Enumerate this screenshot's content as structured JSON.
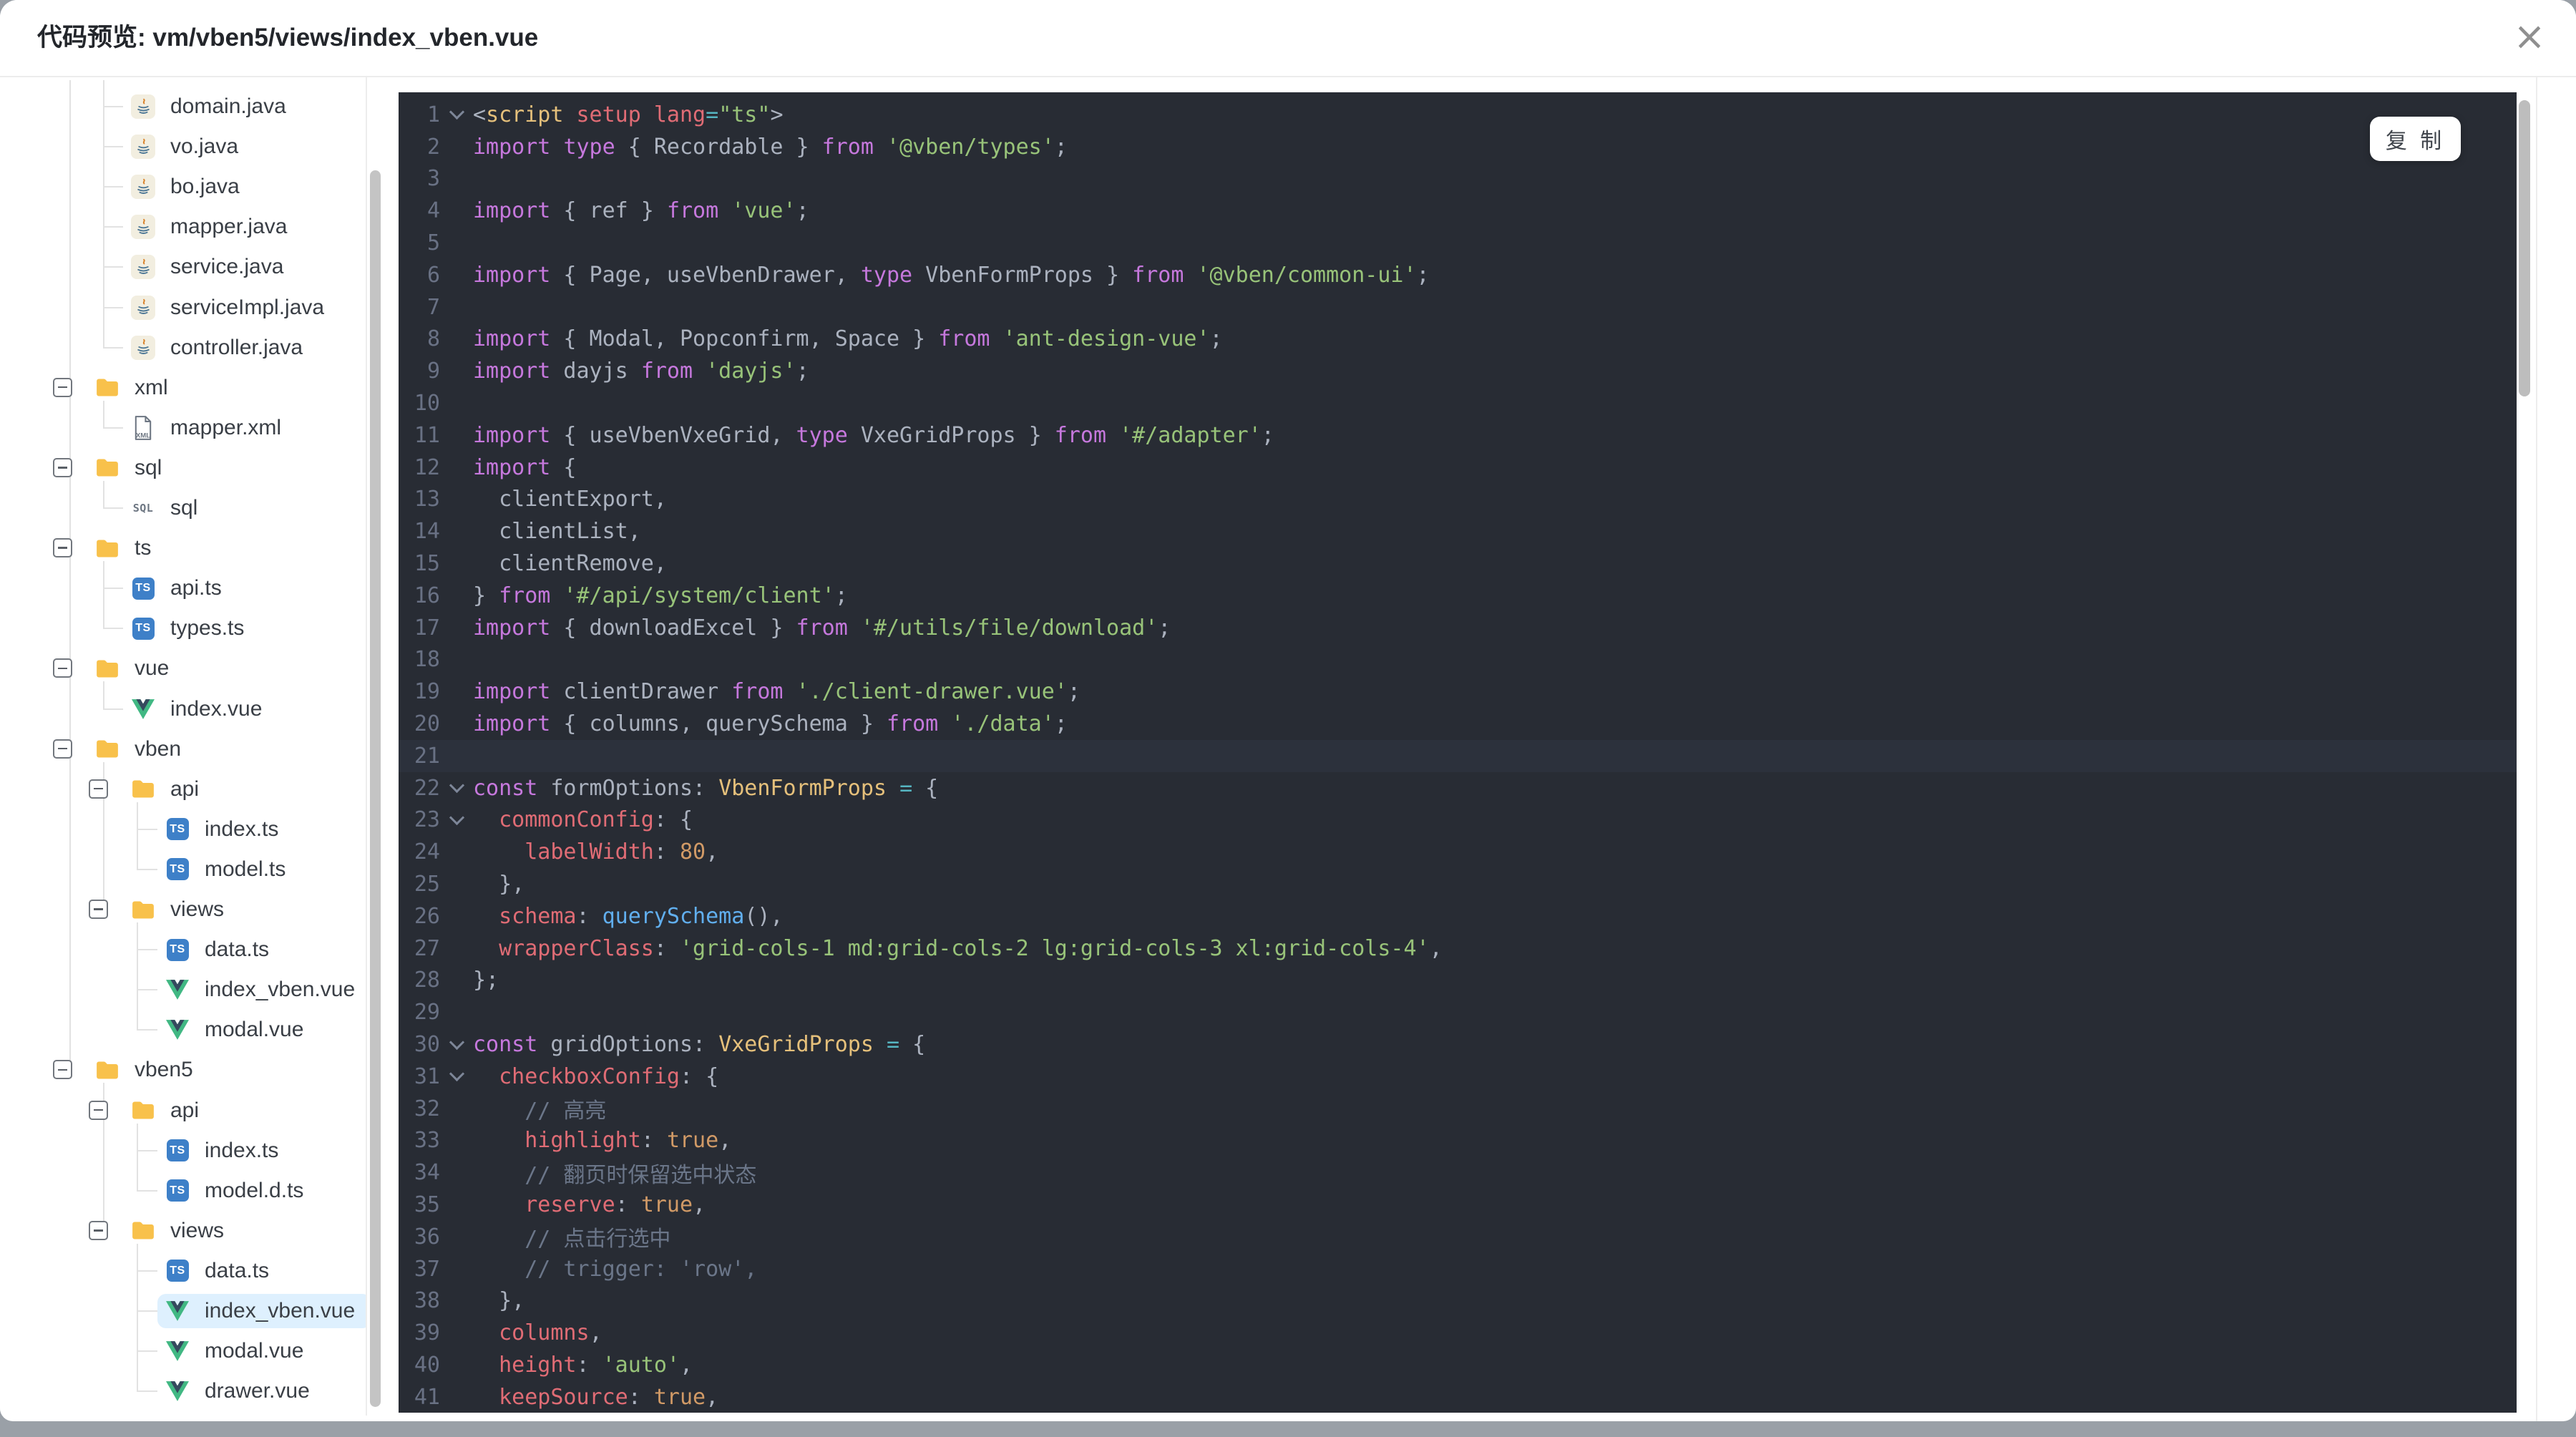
{
  "window": {
    "title": "代码预览: vm/vben5/views/index_vben.vue",
    "close_icon": "×"
  },
  "toolbar": {
    "copy_label": "复 制"
  },
  "theme": {
    "code_background": "#282c34",
    "active_line_background": "#2c313c",
    "selected_row_background": "#def0fe",
    "folder_color": "#f8c14b",
    "ts_icon_color": "#3e80c8",
    "vue_green": "#41b883",
    "vue_dark": "#35495e",
    "line_number_color": "#697184"
  },
  "tree": {
    "items": [
      {
        "label": "domain.java",
        "icon": "java",
        "level": 2,
        "parent": -1,
        "collapser": false,
        "selected": false
      },
      {
        "label": "vo.java",
        "icon": "java",
        "level": 2,
        "parent": -1,
        "collapser": false,
        "selected": false
      },
      {
        "label": "bo.java",
        "icon": "java",
        "level": 2,
        "parent": -1,
        "collapser": false,
        "selected": false
      },
      {
        "label": "mapper.java",
        "icon": "java",
        "level": 2,
        "parent": -1,
        "collapser": false,
        "selected": false
      },
      {
        "label": "service.java",
        "icon": "java",
        "level": 2,
        "parent": -1,
        "collapser": false,
        "selected": false
      },
      {
        "label": "serviceImpl.java",
        "icon": "java",
        "level": 2,
        "parent": -1,
        "collapser": false,
        "selected": false
      },
      {
        "label": "controller.java",
        "icon": "java",
        "level": 2,
        "parent": -1,
        "collapser": false,
        "selected": false
      },
      {
        "label": "xml",
        "icon": "folder",
        "level": 1,
        "parent": null,
        "collapser": true,
        "selected": false
      },
      {
        "label": "mapper.xml",
        "icon": "xml",
        "level": 2,
        "parent": 7,
        "collapser": false,
        "selected": false
      },
      {
        "label": "sql",
        "icon": "folder",
        "level": 1,
        "parent": null,
        "collapser": true,
        "selected": false
      },
      {
        "label": "sql",
        "icon": "sql",
        "level": 2,
        "parent": 9,
        "collapser": false,
        "selected": false
      },
      {
        "label": "ts",
        "icon": "folder",
        "level": 1,
        "parent": null,
        "collapser": true,
        "selected": false
      },
      {
        "label": "api.ts",
        "icon": "ts",
        "level": 2,
        "parent": 11,
        "collapser": false,
        "selected": false
      },
      {
        "label": "types.ts",
        "icon": "ts",
        "level": 2,
        "parent": 11,
        "collapser": false,
        "selected": false
      },
      {
        "label": "vue",
        "icon": "folder",
        "level": 1,
        "parent": null,
        "collapser": true,
        "selected": false
      },
      {
        "label": "index.vue",
        "icon": "vue",
        "level": 2,
        "parent": 14,
        "collapser": false,
        "selected": false
      },
      {
        "label": "vben",
        "icon": "folder",
        "level": 1,
        "parent": null,
        "collapser": true,
        "selected": false
      },
      {
        "label": "api",
        "icon": "folder",
        "level": 2,
        "parent": 16,
        "collapser": true,
        "selected": false
      },
      {
        "label": "index.ts",
        "icon": "ts",
        "level": 3,
        "parent": 17,
        "collapser": false,
        "selected": false
      },
      {
        "label": "model.ts",
        "icon": "ts",
        "level": 3,
        "parent": 17,
        "collapser": false,
        "selected": false
      },
      {
        "label": "views",
        "icon": "folder",
        "level": 2,
        "parent": 16,
        "collapser": true,
        "selected": false
      },
      {
        "label": "data.ts",
        "icon": "ts",
        "level": 3,
        "parent": 20,
        "collapser": false,
        "selected": false
      },
      {
        "label": "index_vben.vue",
        "icon": "vue",
        "level": 3,
        "parent": 20,
        "collapser": false,
        "selected": false
      },
      {
        "label": "modal.vue",
        "icon": "vue",
        "level": 3,
        "parent": 20,
        "collapser": false,
        "selected": false
      },
      {
        "label": "vben5",
        "icon": "folder",
        "level": 1,
        "parent": null,
        "collapser": true,
        "selected": false
      },
      {
        "label": "api",
        "icon": "folder",
        "level": 2,
        "parent": 24,
        "collapser": true,
        "selected": false
      },
      {
        "label": "index.ts",
        "icon": "ts",
        "level": 3,
        "parent": 25,
        "collapser": false,
        "selected": false
      },
      {
        "label": "model.d.ts",
        "icon": "ts",
        "level": 3,
        "parent": 25,
        "collapser": false,
        "selected": false
      },
      {
        "label": "views",
        "icon": "folder",
        "level": 2,
        "parent": 24,
        "collapser": true,
        "selected": false
      },
      {
        "label": "data.ts",
        "icon": "ts",
        "level": 3,
        "parent": 28,
        "collapser": false,
        "selected": false
      },
      {
        "label": "index_vben.vue",
        "icon": "vue",
        "level": 3,
        "parent": 28,
        "collapser": false,
        "selected": true
      },
      {
        "label": "modal.vue",
        "icon": "vue",
        "level": 3,
        "parent": 28,
        "collapser": false,
        "selected": false
      },
      {
        "label": "drawer.vue",
        "icon": "vue",
        "level": 3,
        "parent": 28,
        "collapser": false,
        "selected": false
      }
    ]
  },
  "code": {
    "active_line": 21,
    "fold_lines": [
      1,
      22,
      23,
      30,
      31
    ],
    "lines": [
      {
        "n": 1,
        "t": [
          [
            "def",
            "<"
          ],
          [
            "yel",
            "script"
          ],
          [
            "def",
            " "
          ],
          [
            "red",
            "setup"
          ],
          [
            "def",
            " "
          ],
          [
            "red",
            "lang"
          ],
          [
            "cyn",
            "="
          ],
          [
            "grn",
            "\"ts\""
          ],
          [
            "def",
            ">"
          ]
        ]
      },
      {
        "n": 2,
        "t": [
          [
            "pur",
            "import"
          ],
          [
            "def",
            " "
          ],
          [
            "pur",
            "type"
          ],
          [
            "def",
            " { Recordable } "
          ],
          [
            "pur",
            "from"
          ],
          [
            "def",
            " "
          ],
          [
            "grn",
            "'@vben/types'"
          ],
          [
            "def",
            ";"
          ]
        ]
      },
      {
        "n": 3,
        "t": []
      },
      {
        "n": 4,
        "t": [
          [
            "pur",
            "import"
          ],
          [
            "def",
            " { ref } "
          ],
          [
            "pur",
            "from"
          ],
          [
            "def",
            " "
          ],
          [
            "grn",
            "'vue'"
          ],
          [
            "def",
            ";"
          ]
        ]
      },
      {
        "n": 5,
        "t": []
      },
      {
        "n": 6,
        "t": [
          [
            "pur",
            "import"
          ],
          [
            "def",
            " { Page, useVbenDrawer, "
          ],
          [
            "pur",
            "type"
          ],
          [
            "def",
            " VbenFormProps } "
          ],
          [
            "pur",
            "from"
          ],
          [
            "def",
            " "
          ],
          [
            "grn",
            "'@vben/common-ui'"
          ],
          [
            "def",
            ";"
          ]
        ]
      },
      {
        "n": 7,
        "t": []
      },
      {
        "n": 8,
        "t": [
          [
            "pur",
            "import"
          ],
          [
            "def",
            " { Modal, Popconfirm, Space } "
          ],
          [
            "pur",
            "from"
          ],
          [
            "def",
            " "
          ],
          [
            "grn",
            "'ant-design-vue'"
          ],
          [
            "def",
            ";"
          ]
        ]
      },
      {
        "n": 9,
        "t": [
          [
            "pur",
            "import"
          ],
          [
            "def",
            " dayjs "
          ],
          [
            "pur",
            "from"
          ],
          [
            "def",
            " "
          ],
          [
            "grn",
            "'dayjs'"
          ],
          [
            "def",
            ";"
          ]
        ]
      },
      {
        "n": 10,
        "t": []
      },
      {
        "n": 11,
        "t": [
          [
            "pur",
            "import"
          ],
          [
            "def",
            " { useVbenVxeGrid, "
          ],
          [
            "pur",
            "type"
          ],
          [
            "def",
            " VxeGridProps } "
          ],
          [
            "pur",
            "from"
          ],
          [
            "def",
            " "
          ],
          [
            "grn",
            "'#/adapter'"
          ],
          [
            "def",
            ";"
          ]
        ]
      },
      {
        "n": 12,
        "t": [
          [
            "pur",
            "import"
          ],
          [
            "def",
            " {"
          ]
        ]
      },
      {
        "n": 13,
        "t": [
          [
            "def",
            "  clientExport,"
          ]
        ]
      },
      {
        "n": 14,
        "t": [
          [
            "def",
            "  clientList,"
          ]
        ]
      },
      {
        "n": 15,
        "t": [
          [
            "def",
            "  clientRemove,"
          ]
        ]
      },
      {
        "n": 16,
        "t": [
          [
            "def",
            "} "
          ],
          [
            "pur",
            "from"
          ],
          [
            "def",
            " "
          ],
          [
            "grn",
            "'#/api/system/client'"
          ],
          [
            "def",
            ";"
          ]
        ]
      },
      {
        "n": 17,
        "t": [
          [
            "pur",
            "import"
          ],
          [
            "def",
            " { downloadExcel } "
          ],
          [
            "pur",
            "from"
          ],
          [
            "def",
            " "
          ],
          [
            "grn",
            "'#/utils/file/download'"
          ],
          [
            "def",
            ";"
          ]
        ]
      },
      {
        "n": 18,
        "t": []
      },
      {
        "n": 19,
        "t": [
          [
            "pur",
            "import"
          ],
          [
            "def",
            " clientDrawer "
          ],
          [
            "pur",
            "from"
          ],
          [
            "def",
            " "
          ],
          [
            "grn",
            "'./client-drawer.vue'"
          ],
          [
            "def",
            ";"
          ]
        ]
      },
      {
        "n": 20,
        "t": [
          [
            "pur",
            "import"
          ],
          [
            "def",
            " { columns, querySchema } "
          ],
          [
            "pur",
            "from"
          ],
          [
            "def",
            " "
          ],
          [
            "grn",
            "'./data'"
          ],
          [
            "def",
            ";"
          ]
        ]
      },
      {
        "n": 21,
        "t": []
      },
      {
        "n": 22,
        "t": [
          [
            "pur",
            "const"
          ],
          [
            "def",
            " formOptions: "
          ],
          [
            "yel",
            "VbenFormProps"
          ],
          [
            "def",
            " "
          ],
          [
            "cyn",
            "="
          ],
          [
            "def",
            " {"
          ]
        ]
      },
      {
        "n": 23,
        "t": [
          [
            "def",
            "  "
          ],
          [
            "red",
            "commonConfig"
          ],
          [
            "def",
            ": {"
          ]
        ]
      },
      {
        "n": 24,
        "t": [
          [
            "def",
            "    "
          ],
          [
            "red",
            "labelWidth"
          ],
          [
            "def",
            ": "
          ],
          [
            "org",
            "80"
          ],
          [
            "def",
            ","
          ]
        ]
      },
      {
        "n": 25,
        "t": [
          [
            "def",
            "  },"
          ]
        ]
      },
      {
        "n": 26,
        "t": [
          [
            "def",
            "  "
          ],
          [
            "red",
            "schema"
          ],
          [
            "def",
            ": "
          ],
          [
            "blu",
            "querySchema"
          ],
          [
            "def",
            "(),"
          ]
        ]
      },
      {
        "n": 27,
        "t": [
          [
            "def",
            "  "
          ],
          [
            "red",
            "wrapperClass"
          ],
          [
            "def",
            ": "
          ],
          [
            "grn",
            "'grid-cols-1 md:grid-cols-2 lg:grid-cols-3 xl:grid-cols-4'"
          ],
          [
            "def",
            ","
          ]
        ]
      },
      {
        "n": 28,
        "t": [
          [
            "def",
            "};"
          ]
        ]
      },
      {
        "n": 29,
        "t": []
      },
      {
        "n": 30,
        "t": [
          [
            "pur",
            "const"
          ],
          [
            "def",
            " gridOptions: "
          ],
          [
            "yel",
            "VxeGridProps"
          ],
          [
            "def",
            " "
          ],
          [
            "cyn",
            "="
          ],
          [
            "def",
            " {"
          ]
        ]
      },
      {
        "n": 31,
        "t": [
          [
            "def",
            "  "
          ],
          [
            "red",
            "checkboxConfig"
          ],
          [
            "def",
            ": {"
          ]
        ]
      },
      {
        "n": 32,
        "t": [
          [
            "def",
            "    "
          ],
          [
            "com",
            "// 高亮"
          ]
        ]
      },
      {
        "n": 33,
        "t": [
          [
            "def",
            "    "
          ],
          [
            "red",
            "highlight"
          ],
          [
            "def",
            ": "
          ],
          [
            "org",
            "true"
          ],
          [
            "def",
            ","
          ]
        ]
      },
      {
        "n": 34,
        "t": [
          [
            "def",
            "    "
          ],
          [
            "com",
            "// 翻页时保留选中状态"
          ]
        ]
      },
      {
        "n": 35,
        "t": [
          [
            "def",
            "    "
          ],
          [
            "red",
            "reserve"
          ],
          [
            "def",
            ": "
          ],
          [
            "org",
            "true"
          ],
          [
            "def",
            ","
          ]
        ]
      },
      {
        "n": 36,
        "t": [
          [
            "def",
            "    "
          ],
          [
            "com",
            "// 点击行选中"
          ]
        ]
      },
      {
        "n": 37,
        "t": [
          [
            "def",
            "    "
          ],
          [
            "com",
            "// trigger: 'row',"
          ]
        ]
      },
      {
        "n": 38,
        "t": [
          [
            "def",
            "  },"
          ]
        ]
      },
      {
        "n": 39,
        "t": [
          [
            "def",
            "  "
          ],
          [
            "red",
            "columns"
          ],
          [
            "def",
            ","
          ]
        ]
      },
      {
        "n": 40,
        "t": [
          [
            "def",
            "  "
          ],
          [
            "red",
            "height"
          ],
          [
            "def",
            ": "
          ],
          [
            "grn",
            "'auto'"
          ],
          [
            "def",
            ","
          ]
        ]
      },
      {
        "n": 41,
        "t": [
          [
            "def",
            "  "
          ],
          [
            "red",
            "keepSource"
          ],
          [
            "def",
            ": "
          ],
          [
            "org",
            "true"
          ],
          [
            "def",
            ","
          ]
        ]
      }
    ]
  }
}
